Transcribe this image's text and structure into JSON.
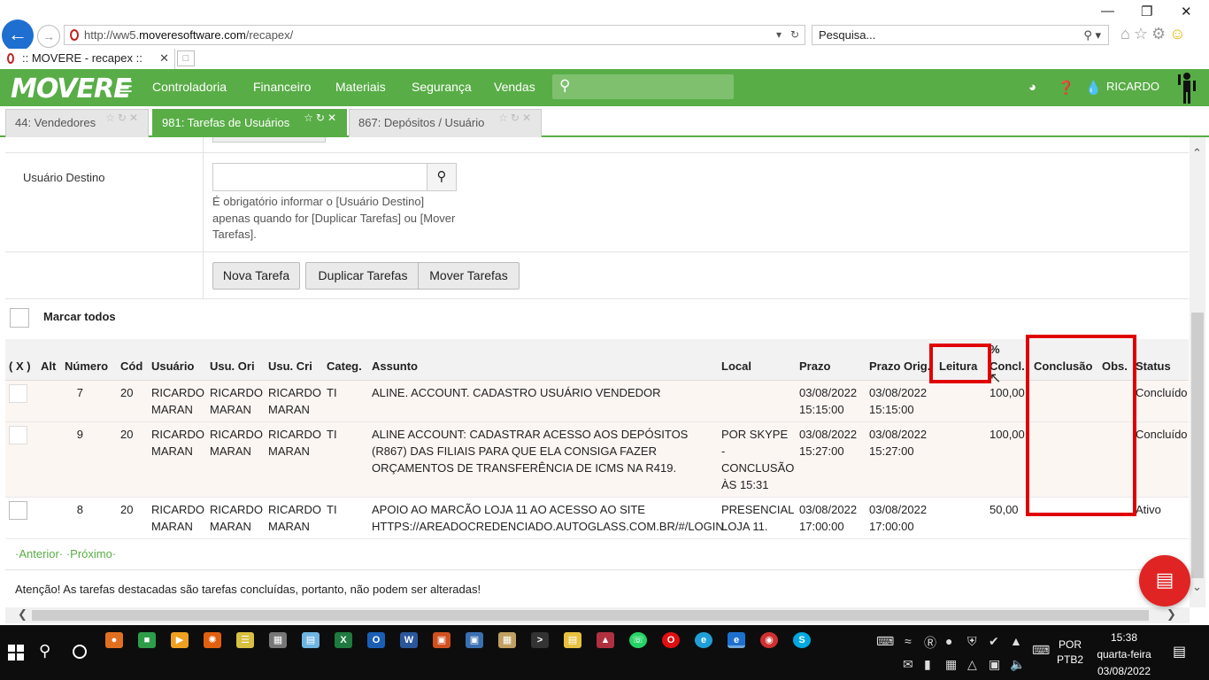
{
  "browser": {
    "url_prefix": "http://ww5.",
    "url_domain": "moveresoftware.com",
    "url_path": "/recapex/",
    "search_placeholder": "Pesquisa...",
    "tab_title": ":: MOVERE - recapex ::"
  },
  "app": {
    "logo": "MOVERE",
    "menu": [
      "Controladoria",
      "Financeiro",
      "Materiais",
      "Segurança",
      "Vendas"
    ],
    "user": "RICARDO",
    "accent_color": "#58ad46"
  },
  "app_tabs": [
    {
      "label": "44: Vendedores"
    },
    {
      "label": "981: Tarefas de Usuários"
    },
    {
      "label": "867: Depósitos / Usuário"
    }
  ],
  "form": {
    "usuario_destino_label": "Usuário Destino",
    "help_text": "É obrigatório informar o [Usuário Destino] apenas quando for [Duplicar Tarefas] ou [Mover Tarefas].",
    "buttons": {
      "nova": "Nova Tarefa",
      "duplicar": "Duplicar Tarefas",
      "mover": "Mover Tarefas"
    },
    "marcar_todos": "Marcar todos"
  },
  "table": {
    "headers": {
      "x": "( X )",
      "alt": "Alt",
      "numero": "Número",
      "cod": "Cód",
      "usuario": "Usuário",
      "usu_ori": "Usu. Ori",
      "usu_cri": "Usu. Cri",
      "categ": "Categ.",
      "assunto": "Assunto",
      "local": "Local",
      "prazo": "Prazo",
      "prazo_orig": "Prazo Orig.",
      "leitura": "Leitura",
      "concl": "% Concl.",
      "conclusao": "Conclusão",
      "obs": "Obs.",
      "status": "Status"
    },
    "rows": [
      {
        "numero": "7",
        "cod": "20",
        "usuario": "RICARDO MARAN",
        "usu_ori": "RICARDO MARAN",
        "usu_cri": "RICARDO MARAN",
        "categ": "TI",
        "assunto": "ALINE. ACCOUNT. CADASTRO USUÁRIO VENDEDOR",
        "local": "",
        "prazo": "03/08/2022 15:15:00",
        "prazo_orig": "03/08/2022 15:15:00",
        "leitura": "",
        "concl": "100,00",
        "conclusao": "",
        "obs": "",
        "status": "Concluído"
      },
      {
        "numero": "9",
        "cod": "20",
        "usuario": "RICARDO MARAN",
        "usu_ori": "RICARDO MARAN",
        "usu_cri": "RICARDO MARAN",
        "categ": "TI",
        "assunto": "ALINE ACCOUNT: CADASTRAR ACESSO AOS DEPÓSITOS (R867) DAS FILIAIS PARA QUE ELA CONSIGA FAZER ORÇAMENTOS DE TRANSFERÊNCIA DE ICMS NA R419.",
        "local": "POR SKYPE - CONCLUSÃO ÀS 15:31",
        "prazo": "03/08/2022 15:27:00",
        "prazo_orig": "03/08/2022 15:27:00",
        "leitura": "",
        "concl": "100,00",
        "conclusao": "",
        "obs": "",
        "status": "Concluído"
      },
      {
        "numero": "8",
        "cod": "20",
        "usuario": "RICARDO MARAN",
        "usu_ori": "RICARDO MARAN",
        "usu_cri": "RICARDO MARAN",
        "categ": "TI",
        "assunto": "APOIO AO MARCÃO LOJA 11 AO ACESSO AO SITE HTTPS://AREADOCREDENCIADO.AUTOGLASS.COM.BR/#/LOGIN.",
        "local": "PRESENCIAL LOJA 11.",
        "prazo": "03/08/2022 17:00:00",
        "prazo_orig": "03/08/2022 17:00:00",
        "leitura": "",
        "concl": "50,00",
        "conclusao": "",
        "obs": "",
        "status": "Ativo"
      }
    ]
  },
  "pager": {
    "prev": "·Anterior·",
    "next": "·Próximo·"
  },
  "warning": "Atenção! As tarefas destacadas são tarefas concluídas, portanto, não podem ser alteradas!",
  "taskbar": {
    "lang_line1": "POR",
    "lang_line2": "PTB2",
    "time": "15:38",
    "weekday": "quarta-feira",
    "date": "03/08/2022"
  }
}
